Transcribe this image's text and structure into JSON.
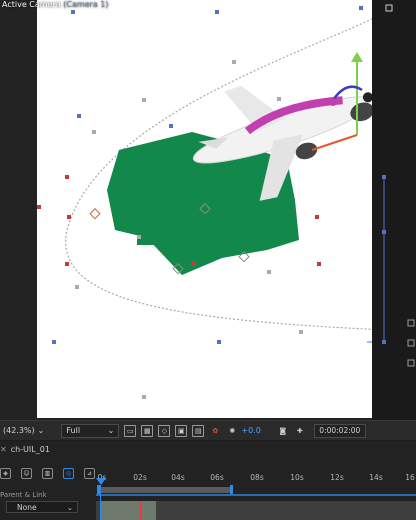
{
  "viewer": {
    "camera_name": "Active Camera",
    "camera_sub": "(Camera 1)"
  },
  "toolbar": {
    "zoom": "(42.3%)",
    "zoom_chevron": "⌄",
    "resolution": "Full",
    "resolution_chevron": "⌄",
    "exposure": "+0.0",
    "timecode": "0:00:02:00"
  },
  "timeline": {
    "comp_name": "ch-UIL_01",
    "parent_label": "Parent & Link",
    "parent_value": "None",
    "parent_chevron": "⌄",
    "ticks": [
      "0s",
      "02s",
      "04s",
      "06s",
      "08s",
      "10s",
      "12s",
      "14s",
      "16"
    ]
  },
  "colors": {
    "logo_green": "#12894a",
    "accent_blue": "#2d8ceb",
    "path_gray": "#a9a9a9"
  }
}
